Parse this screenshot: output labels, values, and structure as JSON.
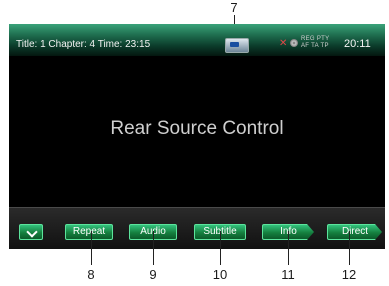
{
  "callouts": {
    "top": "7",
    "b8": "8",
    "b9": "9",
    "b10": "10",
    "b11": "11",
    "b12": "12"
  },
  "status": {
    "info": "Title: 1 Chapter: 4 Time: 23:15",
    "rds_line1": "REG PTY",
    "rds_line2": "AF TA TP",
    "clock": "20:11"
  },
  "main": {
    "title": "Rear Source Control"
  },
  "buttons": {
    "down": "",
    "repeat": "Repeat",
    "audio": "Audio",
    "subtitle": "Subtitle",
    "info": "Info",
    "direct": "Direct"
  },
  "icons": {
    "down": "chevron-down-icon",
    "source": "stb-source-icon",
    "mute": "mute-icon",
    "disc": "disc-icon"
  },
  "colors": {
    "button": "#1f9a55",
    "button_border": "#5ce49c",
    "status_top": "#3aa37a",
    "screen_bg": "#000000"
  }
}
